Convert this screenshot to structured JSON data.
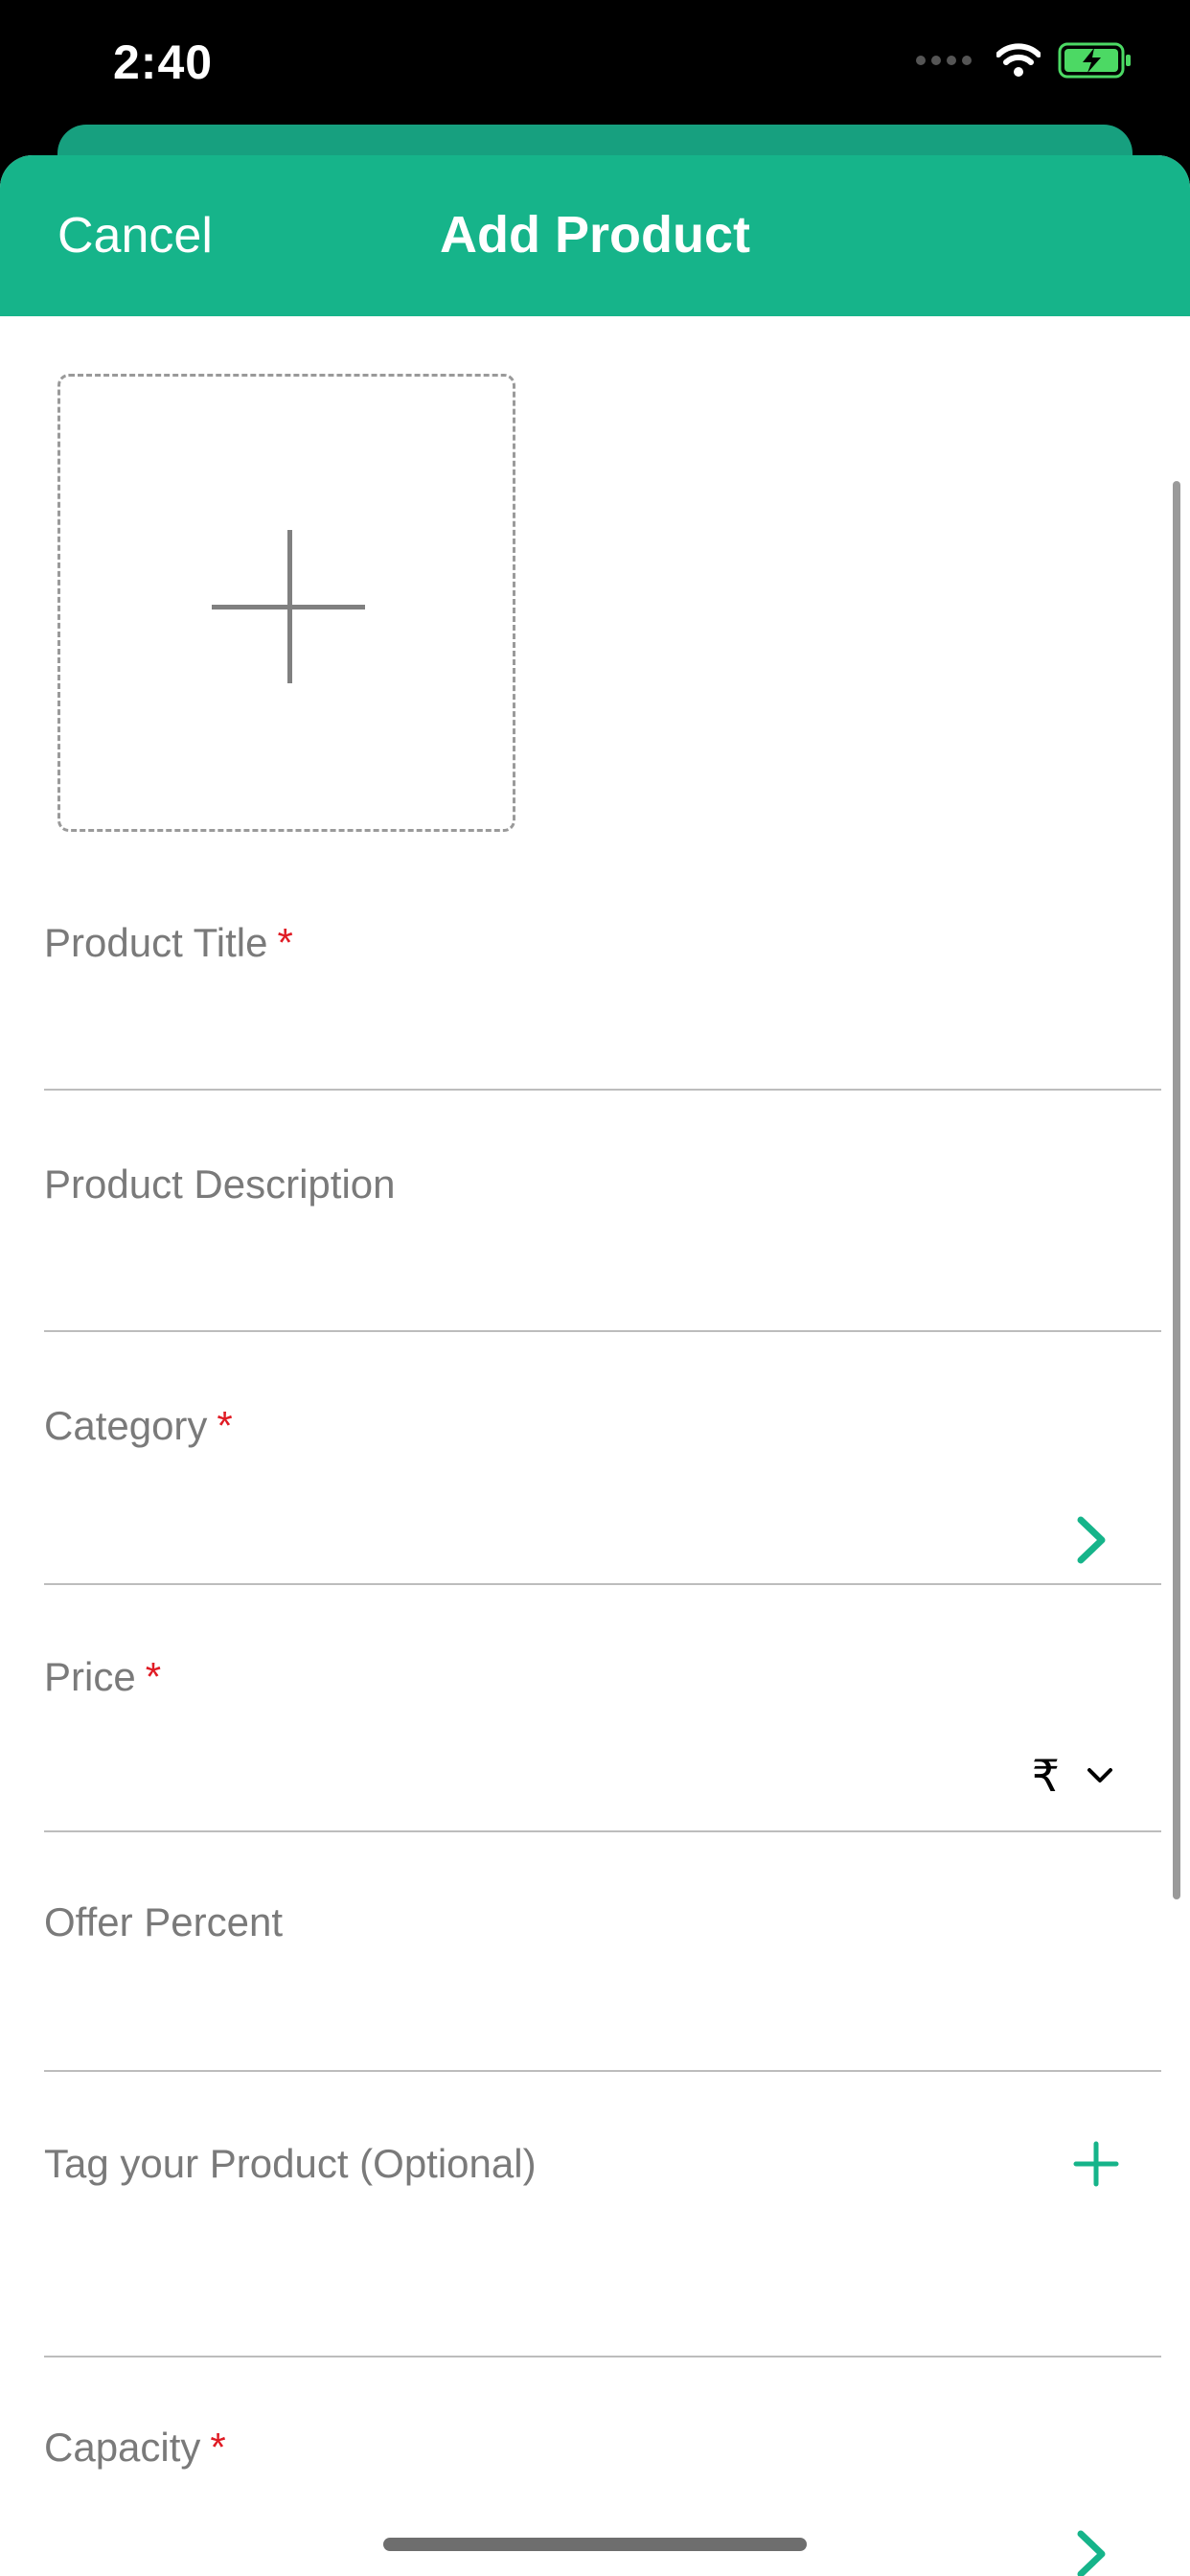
{
  "status": {
    "time": "2:40"
  },
  "nav": {
    "cancel": "Cancel",
    "title": "Add Product"
  },
  "image_picker": {
    "icon": "plus-icon"
  },
  "fields": {
    "title": {
      "label": "Product Title",
      "required": "*"
    },
    "description": {
      "label": "Product Description"
    },
    "category": {
      "label": "Category",
      "required": "*"
    },
    "price": {
      "label": "Price",
      "required": "*",
      "currency": "₹"
    },
    "offer": {
      "label": "Offer Percent"
    },
    "tag": {
      "label": "Tag your Product (Optional)"
    },
    "capacity": {
      "label": "Capacity",
      "required": "*"
    }
  },
  "colors": {
    "accent": "#16b48a",
    "required": "#e01b24"
  }
}
